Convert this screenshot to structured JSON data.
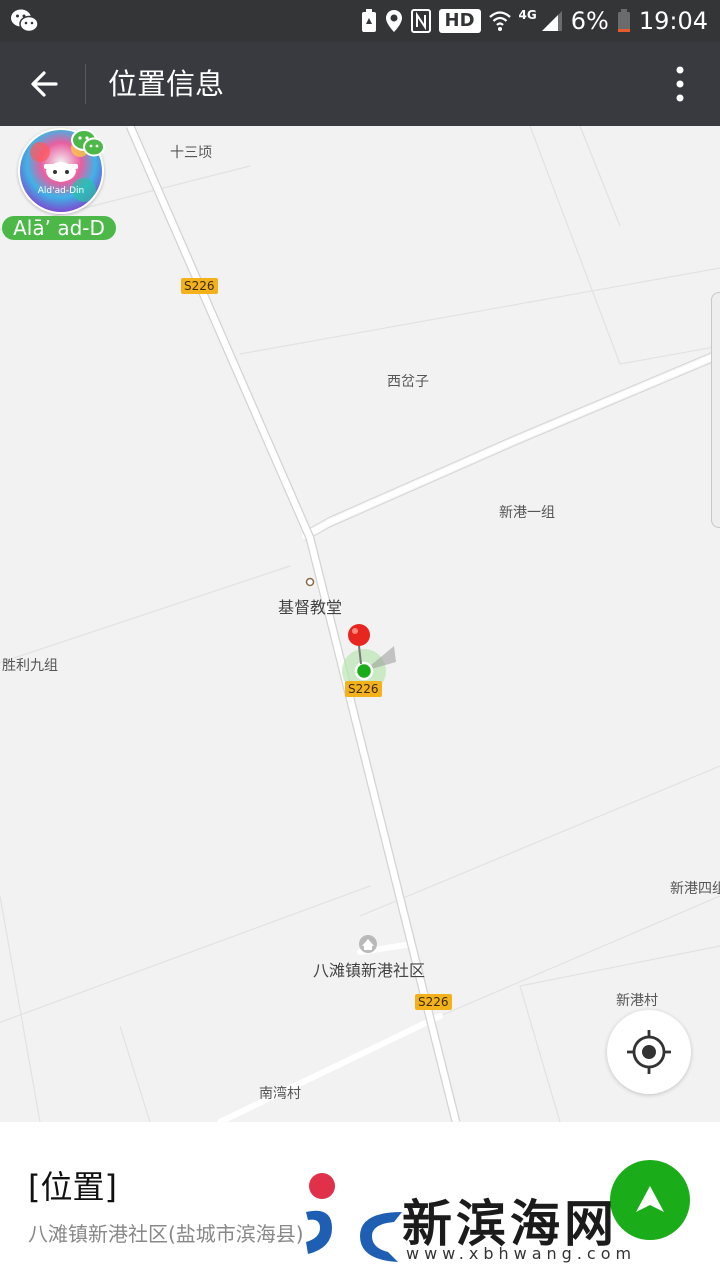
{
  "status_bar": {
    "battery": "6%",
    "time": "19:04",
    "hd_badge": "HD",
    "network": "4G",
    "icons": [
      "wechat-icon",
      "battery-saver-icon",
      "location-icon",
      "nfc-icon",
      "wifi-icon",
      "signal-icon",
      "battery-icon"
    ]
  },
  "app_bar": {
    "title": "位置信息",
    "back_icon": "arrow-left-icon",
    "menu_icon": "more-vertical-icon"
  },
  "map": {
    "labels": {
      "shisanqing": "十三顷",
      "xichazi": "西岔子",
      "xingang_yizu": "新港一组",
      "jidu_jiaotang": "基督教堂",
      "shengli_jiuzu": "胜利九组",
      "xingang_sizu": "新港四组",
      "batanzhen": "八滩镇新港社区",
      "xingangcun": "新港村",
      "nanwancun": "南湾村"
    },
    "road_shields": [
      "S226",
      "S226",
      "S226"
    ],
    "user_name": "Alā’ ad-D",
    "avatar_text": "Ald'ad-Din",
    "colors": {
      "road_shield": "#f3b21b",
      "marker": "#e8261f",
      "user_dot": "#1aad19",
      "name_tag": "#4cb848"
    }
  },
  "bottom_panel": {
    "title": "[位置]",
    "address": "八滩镇新港社区(盐城市滨海县)",
    "nav_icon": "navigation-icon"
  },
  "watermark": {
    "text": "新滨海网",
    "url": "www.xbhwang.com"
  }
}
